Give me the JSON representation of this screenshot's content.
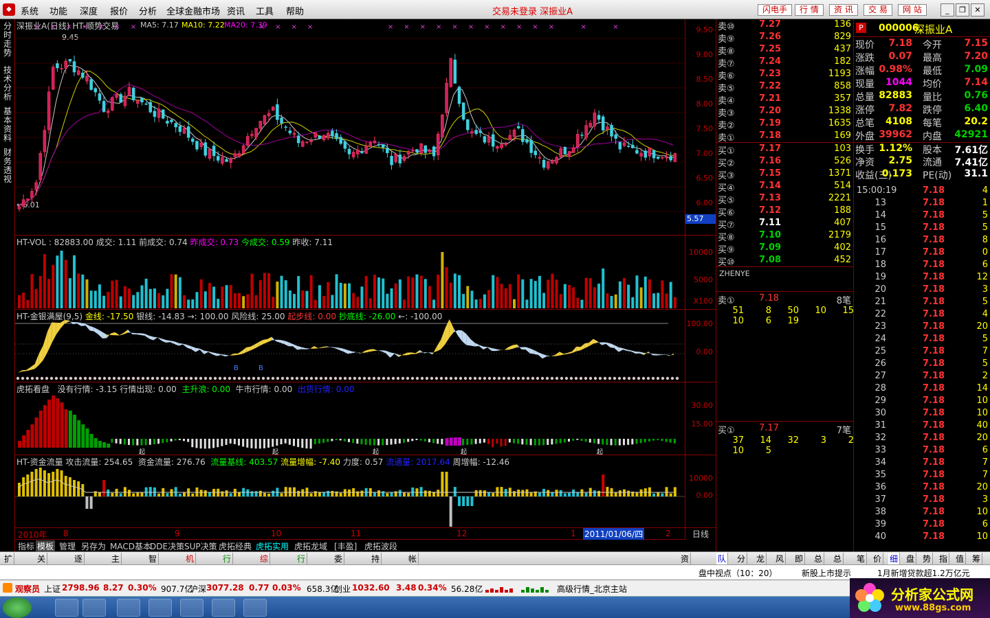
{
  "menu": {
    "items": [
      "系统",
      "功能",
      "深度",
      "报价",
      "分析",
      "全球金融市场",
      "资讯",
      "工具",
      "帮助"
    ],
    "center": "交易未登录  深振业A",
    "buttons": [
      "闪电手",
      "行 情",
      "资 讯",
      "交 易",
      "网 站"
    ]
  },
  "lefttabs": [
    "分时走势",
    "技术分析",
    "基本资料",
    "财务透视"
  ],
  "kline": {
    "title": "深振业A(日线) HT-顺势交易",
    "ma5": "MA5: 7.17",
    "ma10": "MA10: 7.22",
    "ma20": "MA20: 7.39",
    "high": "9.45",
    "low": "←6.01",
    "axis": [
      "9.50",
      "9.00",
      "8.50",
      "8.00",
      "7.50",
      "7.00",
      "6.50",
      "6.00"
    ],
    "price_tag": "5.57"
  },
  "vol": {
    "title": "HT-VOL : 82883.00",
    "items": [
      "成交: 1.11",
      "前成交: 0.74",
      "昨成交: 0.73",
      "今成交: 0.59",
      "昨收: 7.11"
    ],
    "axis": [
      "10000",
      "5000"
    ],
    "unit": "X100"
  },
  "jy": {
    "title": "HT-金银满屋(9,5)",
    "items": [
      "金线: -17.50",
      "银线: -14.83",
      "→: 100.00",
      "风险线: 25.00",
      "起步线: 0.00",
      "抄底线: -26.00",
      "←: -100.00"
    ],
    "axis": [
      "100.00",
      "0.00"
    ]
  },
  "ht": {
    "title": "虎拓看盘",
    "items": [
      "没有行情: -3.15",
      "行情出现: 0.00",
      "主升浪: 0.00",
      "牛市行情: 0.00",
      "出货行情: 0.00"
    ],
    "axis": [
      "30.00",
      "15.00"
    ]
  },
  "zj": {
    "title": "HT-资金流量",
    "items": [
      "攻击流量: 254.65",
      "资金流量: 276.76",
      "流量基线: 403.57",
      "流量增幅: -7.40",
      "力度: 0.57",
      "流通量: 2017.64",
      "周增幅: -12.46"
    ],
    "axis": [
      "10000",
      "0.00"
    ]
  },
  "dates": [
    "2010年",
    "8",
    "9",
    "10",
    "11",
    "12",
    "1",
    "2011/01/06/四",
    "2"
  ],
  "date_right": "日线",
  "btabs": [
    "指标",
    "模板",
    "管理",
    "另存为",
    "MACD基本",
    "DDE决策",
    "SUP决策",
    "虎拓经典",
    "虎拓实用",
    "虎拓龙域",
    "[丰盈]",
    "虎拓波段"
  ],
  "sells": [
    [
      "卖⑩",
      "7.27",
      "136"
    ],
    [
      "卖⑨",
      "7.26",
      "829"
    ],
    [
      "卖⑧",
      "7.25",
      "437"
    ],
    [
      "卖⑦",
      "7.24",
      "182"
    ],
    [
      "卖⑥",
      "7.23",
      "1193"
    ],
    [
      "卖⑤",
      "7.22",
      "858"
    ],
    [
      "卖④",
      "7.21",
      "357"
    ],
    [
      "卖③",
      "7.20",
      "1338"
    ],
    [
      "卖②",
      "7.19",
      "1635"
    ],
    [
      "卖①",
      "7.18",
      "169"
    ]
  ],
  "buys": [
    [
      "买①",
      "7.17",
      "103"
    ],
    [
      "买②",
      "7.16",
      "526"
    ],
    [
      "买③",
      "7.15",
      "1371"
    ],
    [
      "买④",
      "7.14",
      "514"
    ],
    [
      "买⑤",
      "7.13",
      "2221"
    ],
    [
      "买⑥",
      "7.12",
      "188"
    ],
    [
      "买⑦",
      "7.11",
      "407"
    ],
    [
      "买⑧",
      "7.10",
      "2179"
    ],
    [
      "买⑨",
      "7.09",
      "402"
    ],
    [
      "买⑩",
      "7.08",
      "452"
    ]
  ],
  "zhenye": "ZHENYE",
  "queue_sell": {
    "label": "卖①",
    "price": "7.18",
    "count": "8笔",
    "rows": [
      [
        "51",
        "8",
        "50",
        "10",
        "15"
      ],
      [
        "10",
        "6",
        "19"
      ]
    ]
  },
  "queue_buy": {
    "label": "买①",
    "price": "7.17",
    "count": "7笔",
    "rows": [
      [
        "37",
        "14",
        "32",
        "3",
        "2"
      ],
      [
        "10",
        "5"
      ]
    ]
  },
  "stock": {
    "p": "P",
    "code": "000006",
    "name": "深振业A"
  },
  "quote": [
    [
      "现价",
      "7.18",
      "今开",
      "7.15"
    ],
    [
      "涨跌",
      "0.07",
      "最高",
      "7.20"
    ],
    [
      "涨幅",
      "0.98%",
      "最低",
      "7.09"
    ],
    [
      "现量",
      "1044",
      "均价",
      "7.14"
    ],
    [
      "总量",
      "82883",
      "量比",
      "0.76"
    ],
    [
      "涨停",
      "7.82",
      "跌停",
      "6.40"
    ],
    [
      "总笔",
      "4108",
      "每笔",
      "20.2"
    ],
    [
      "外盘",
      "39962",
      "内盘",
      "42921"
    ],
    [
      "换手",
      "1.12%",
      "股本",
      "7.61亿"
    ],
    [
      "净资",
      "2.75",
      "流通",
      "7.41亿"
    ],
    [
      "收益(三)",
      "0.173",
      "PE(动)",
      "31.1"
    ]
  ],
  "ticks": [
    [
      "15:00:19",
      "7.18",
      "4"
    ],
    [
      "13",
      "7.18",
      "1"
    ],
    [
      "14",
      "7.18",
      "5"
    ],
    [
      "15",
      "7.18",
      "5"
    ],
    [
      "16",
      "7.18",
      "8"
    ],
    [
      "17",
      "7.18",
      "0"
    ],
    [
      "18",
      "7.18",
      "6"
    ],
    [
      "19",
      "7.18",
      "12"
    ],
    [
      "20",
      "7.18",
      "3"
    ],
    [
      "21",
      "7.18",
      "5"
    ],
    [
      "22",
      "7.18",
      "4"
    ],
    [
      "23",
      "7.18",
      "20"
    ],
    [
      "24",
      "7.18",
      "5"
    ],
    [
      "25",
      "7.18",
      "7"
    ],
    [
      "26",
      "7.18",
      "5"
    ],
    [
      "27",
      "7.18",
      "2"
    ],
    [
      "28",
      "7.18",
      "14"
    ],
    [
      "29",
      "7.18",
      "10"
    ],
    [
      "30",
      "7.18",
      "10"
    ],
    [
      "31",
      "7.18",
      "40"
    ],
    [
      "32",
      "7.18",
      "20"
    ],
    [
      "33",
      "7.18",
      "6"
    ],
    [
      "34",
      "7.18",
      "7"
    ],
    [
      "35",
      "7.18",
      "7"
    ],
    [
      "36",
      "7.18",
      "20"
    ],
    [
      "37",
      "7.18",
      "3"
    ],
    [
      "38",
      "7.18",
      "10"
    ],
    [
      "39",
      "7.18",
      "6"
    ],
    [
      "40",
      "7.18",
      "10"
    ]
  ],
  "tabs2_left": [
    "扩展区",
    "关联报价",
    "逐笔委托",
    "主力轨迹",
    "智能解盘",
    "机构攻略",
    "行业攻略",
    "综合资讯",
    "行业资讯",
    "委托成交",
    "持仓股份",
    "帐户资金"
  ],
  "tabs2_mid": [
    "资讯工场",
    "队列",
    "分布",
    "龙虎",
    "风向",
    "即散",
    "总散",
    "总委"
  ],
  "tabs2_right": [
    "笔",
    "价",
    "细",
    "盘",
    "势",
    "指",
    "值",
    "筹"
  ],
  "info": [
    "盘中视点（10：20）",
    "新股上市提示",
    "1月新增贷款超1.2万亿元"
  ],
  "status": {
    "obs": "观察员",
    "sh": "上证",
    "sh_v": "2798.96",
    "sh_c": "8.27",
    "sh_p": "0.30%",
    "sh_a": "907.7亿",
    "sz": "沪深",
    "sz_v": "3077.28",
    "sz_c": "0.77",
    "sz_p": "0.03%",
    "sz_a": "658.3亿",
    "cy": "创业",
    "cy_v": "1032.60",
    "cy_c": "3.48",
    "cy_p": "0.34%",
    "cy_a": "56.28亿",
    "server": "高级行情_北京主站"
  },
  "brand": {
    "name": "分析家公式网",
    "url": "www.88gs.com"
  },
  "colors": {
    "up": "#ff3232",
    "down": "#00e0e0",
    "yellow": "#ffff00",
    "frame": "#800000"
  }
}
